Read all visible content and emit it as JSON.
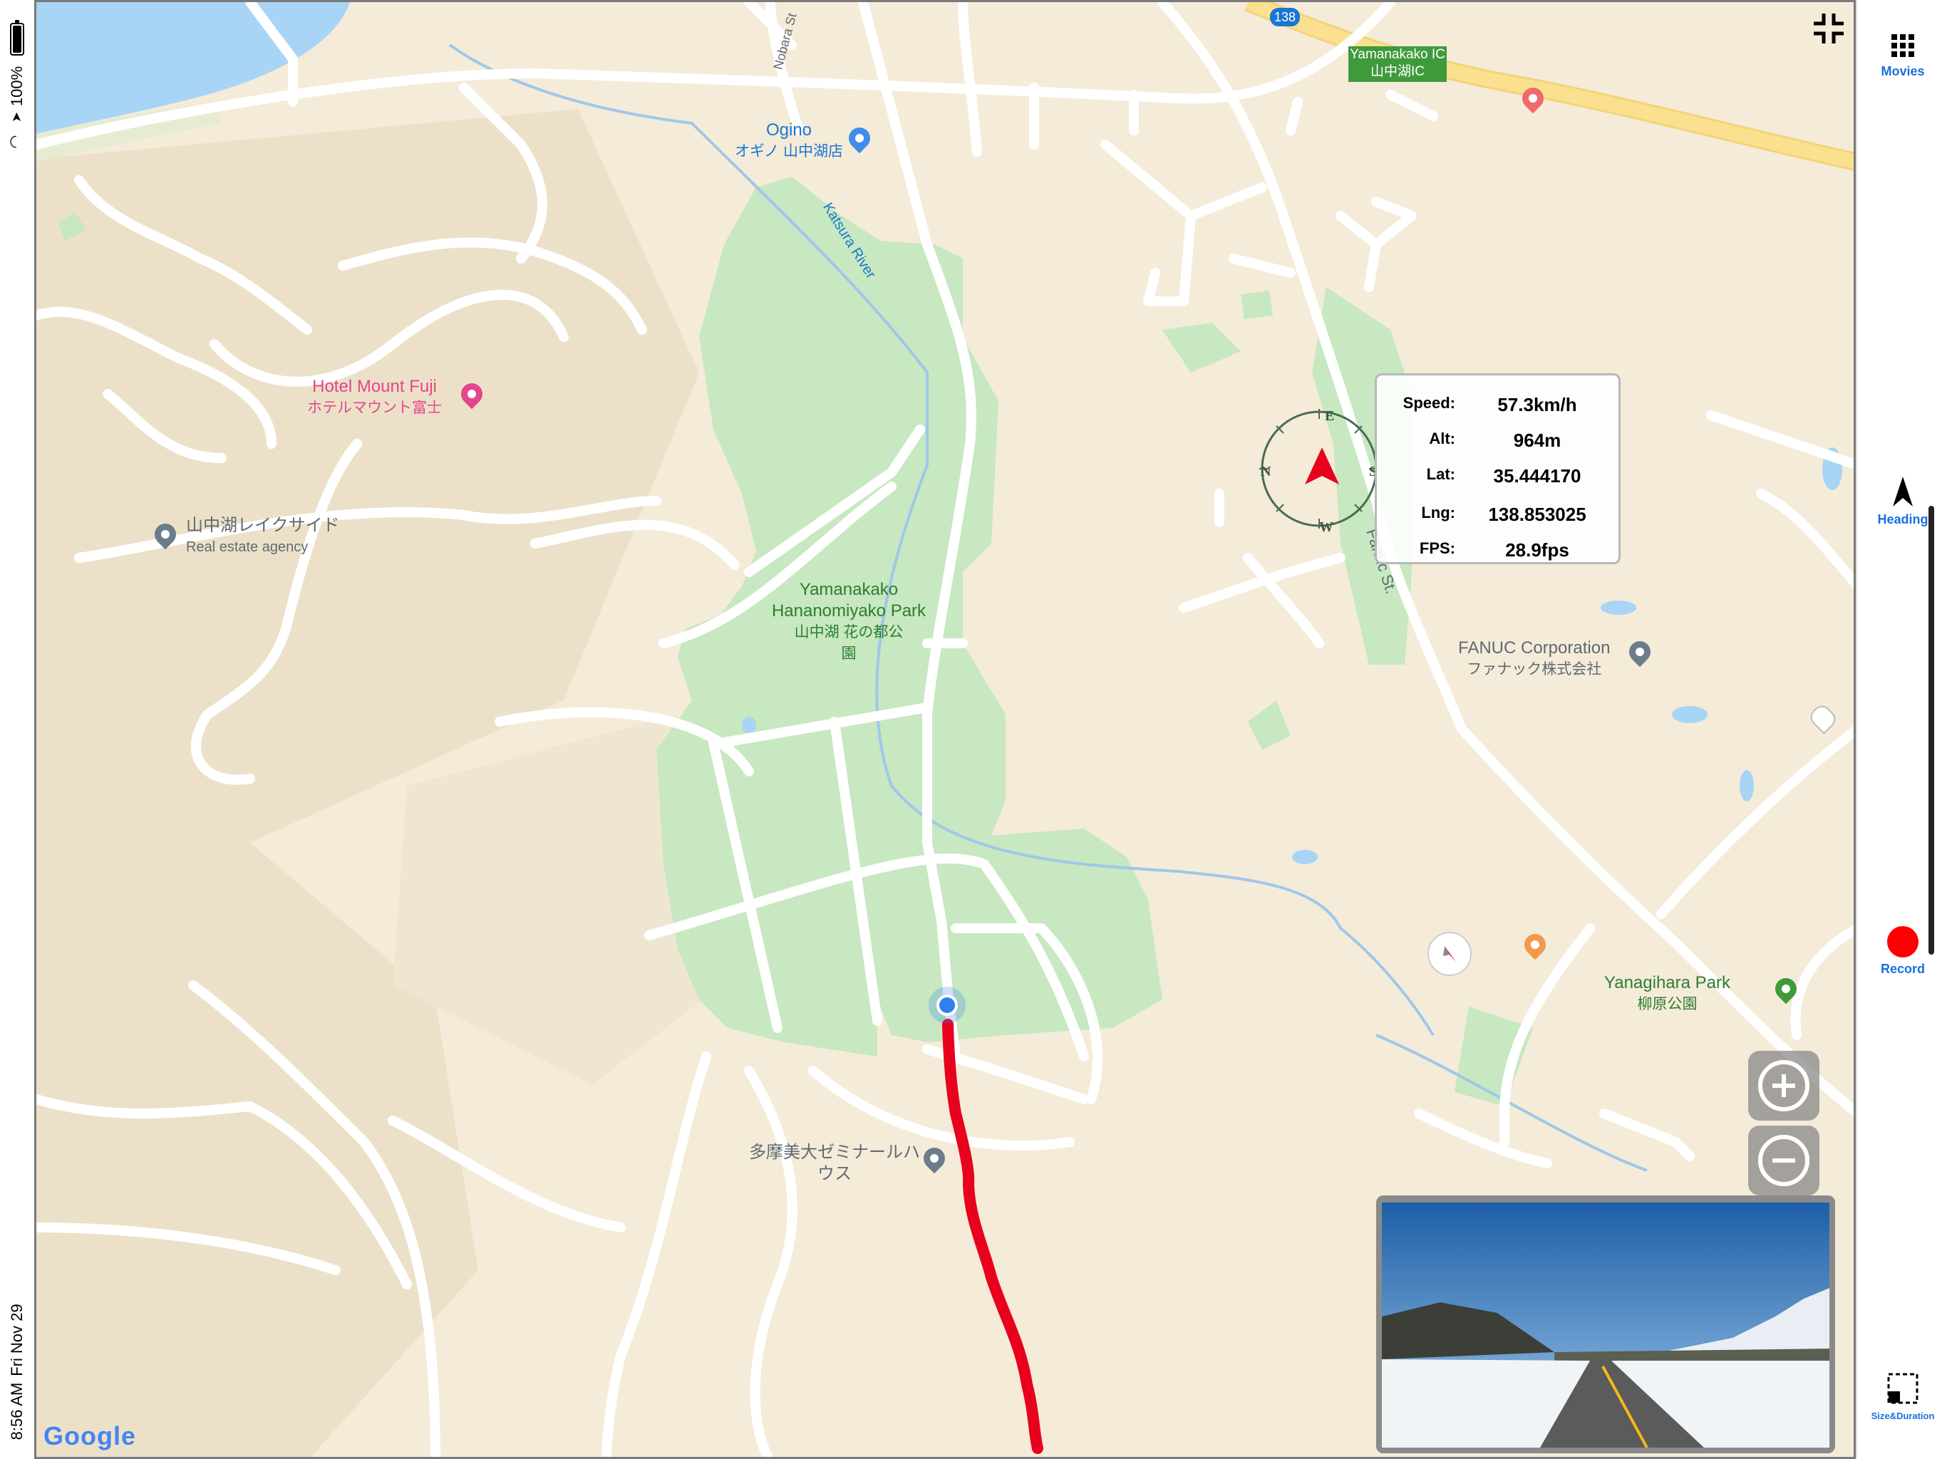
{
  "status_bar": {
    "time": "8:56 AM",
    "date": "Fri Nov 29",
    "battery": "100%"
  },
  "map": {
    "provider_logo": "Google",
    "road_badge": "138",
    "ic_sign": {
      "line1": "Yamanakako IC",
      "line2": "山中湖IC"
    },
    "street_labels": {
      "nobara": "Nobara St",
      "katsura": "Katsura River",
      "fanuc": "Fanuc St."
    },
    "pois": {
      "ogino": {
        "name": "Ogino",
        "sub": "オギノ 山中湖店"
      },
      "hotel": {
        "name": "Hotel Mount Fuji",
        "sub": "ホテルマウント富士"
      },
      "lakeside": {
        "name": "山中湖レイクサイド",
        "sub": "Real estate agency"
      },
      "park": {
        "name": "Yamanakako Hananomiyako Park",
        "sub": "山中湖 花の都公園"
      },
      "fanuc": {
        "name": "FANUC Corporation",
        "sub": "ファナック株式会社"
      },
      "tama": {
        "name": "多摩美大ゼミナールハウス"
      },
      "yanagihara": {
        "name": "Yanagihara Park",
        "sub": "柳原公園"
      }
    },
    "compass_letters": {
      "n": "N",
      "e": "E",
      "s": "S",
      "w": "W"
    },
    "colors": {
      "land": "#f5ebd9",
      "terrain": "#ebe0c5",
      "park": "#c7e8c0",
      "water": "#a8d4f5",
      "road": "#ffffff",
      "highway": "#fbe18f",
      "track": "#e8001c",
      "location_dot": "#2f80ed"
    }
  },
  "info_panel": {
    "rows": [
      {
        "label": "Speed:",
        "value": "57.3km/h"
      },
      {
        "label": "Alt:",
        "value": "964m"
      },
      {
        "label": "Lat:",
        "value": "35.444170"
      },
      {
        "label": "Lng:",
        "value": "138.853025"
      },
      {
        "label": "FPS:",
        "value": "28.9fps"
      }
    ]
  },
  "toolbar": {
    "movies": {
      "label": "Movies",
      "icon": "grid-icon"
    },
    "heading": {
      "label": "Heading",
      "icon": "heading-arrow-icon"
    },
    "record": {
      "label": "Record",
      "icon": "record-dot-icon"
    },
    "size_duration": {
      "label": "Size&Duration",
      "icon": "resize-icon"
    }
  },
  "controls": {
    "collapse": {
      "icon": "collapse-icon"
    },
    "zoom_in": {
      "icon": "zoom-in-icon"
    },
    "zoom_out": {
      "icon": "zoom-out-icon"
    },
    "mini_compass": {
      "icon": "compass-needle-icon"
    }
  }
}
